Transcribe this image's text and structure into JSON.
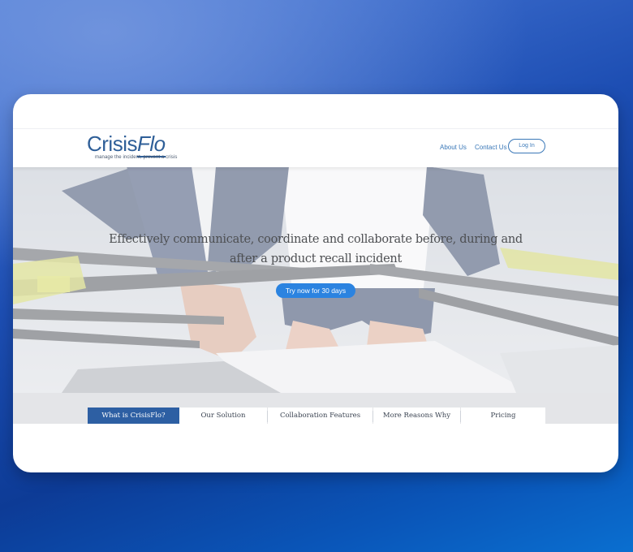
{
  "logo": {
    "crisis": "Crisis",
    "flo": "Flo",
    "tagline": "manage the incident, prevent a crisis"
  },
  "nav": {
    "about": "About Us",
    "contact": "Contact Us",
    "login": "Log In"
  },
  "hero": {
    "headline": "Effectively communicate, coordinate and collaborate before, during and after a product recall incident",
    "cta": "Try now for 30 days",
    "image": "rowing-crew-photo"
  },
  "tabs": [
    {
      "label": "What is CrisisFlo?",
      "active": true
    },
    {
      "label": "Our Solution",
      "active": false
    },
    {
      "label": "Collaboration Features",
      "active": false
    },
    {
      "label": "More Reasons Why",
      "active": false
    },
    {
      "label": "Pricing",
      "active": false
    }
  ],
  "colors": {
    "brand": "#2f5f98",
    "link": "#3a78b8",
    "cta": "#2b83e0",
    "active_tab": "#2d5fa3"
  }
}
